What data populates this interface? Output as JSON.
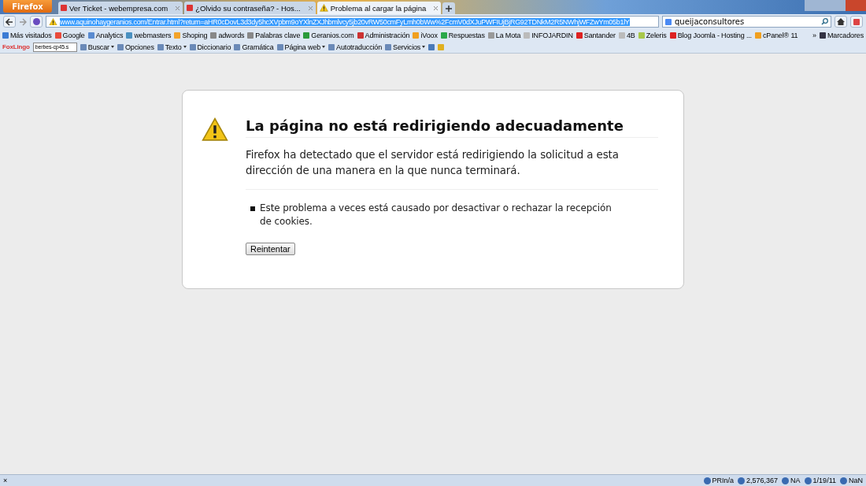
{
  "app_button": "Firefox",
  "tabs": [
    {
      "title": "Ver Ticket - webempresa.com",
      "selected": false,
      "kind": "site"
    },
    {
      "title": "¿Olvido su contraseña? - Hos...",
      "selected": false,
      "kind": "site"
    },
    {
      "title": "Problema al cargar la página",
      "selected": true,
      "kind": "warning"
    }
  ],
  "address_bar": {
    "url": "www.aquinohaygeranios.com/Entrar.html?return=aHR0cDovL3d3dy5hcXVpbm9oYXlnZXJhbmlvcy5jb20vRW50cmFyLmh0bWw%2FcmV0dXJuPWFIUjBjRG92TDNkM2R5NWhjWFZwYm05b1lY",
    "selected": true
  },
  "search_field": {
    "value": "queijaconsultores"
  },
  "bookmarks": [
    "Más visitados",
    "Google",
    "Analytics",
    "webmasters",
    "Shoping",
    "adwords",
    "Palabras clave",
    "Geranios.com",
    "Administración",
    "iVoox",
    "Respuestas",
    "La Mota",
    "INFOJARDIN",
    "Santander",
    "4B",
    "Zeleris",
    "Blog Joomla - Hosting ...",
    "cPanel® 11"
  ],
  "bookmarks_more": "»",
  "bookmarks_menu": "Marcadores",
  "foxlingo": {
    "logo": "FoxLingo",
    "language": "berbes-cp45.s",
    "items": [
      {
        "label": "Buscar",
        "dropdown": true
      },
      {
        "label": "Opciones",
        "dropdown": false
      },
      {
        "label": "Texto",
        "dropdown": true
      },
      {
        "label": "Diccionario",
        "dropdown": false
      },
      {
        "label": "Gramática",
        "dropdown": false
      },
      {
        "label": "Página web",
        "dropdown": true
      },
      {
        "label": "Autotraducción",
        "dropdown": false
      },
      {
        "label": "Servicios",
        "dropdown": true
      }
    ]
  },
  "error": {
    "title": "La página no está redirigiendo adecuadamente",
    "message": "Firefox ha detectado que el servidor está redirigiendo la solicitud a esta dirección de una manera en la que nunca terminará.",
    "hints": [
      "Este problema a veces está causado por desactivar o rechazar la recepción de cookies."
    ],
    "button": "Reintentar"
  },
  "status_bar": {
    "close": "×",
    "items": [
      "PRIn/a",
      "2,576,367",
      "NA",
      "1/19/11",
      "NaN"
    ]
  }
}
